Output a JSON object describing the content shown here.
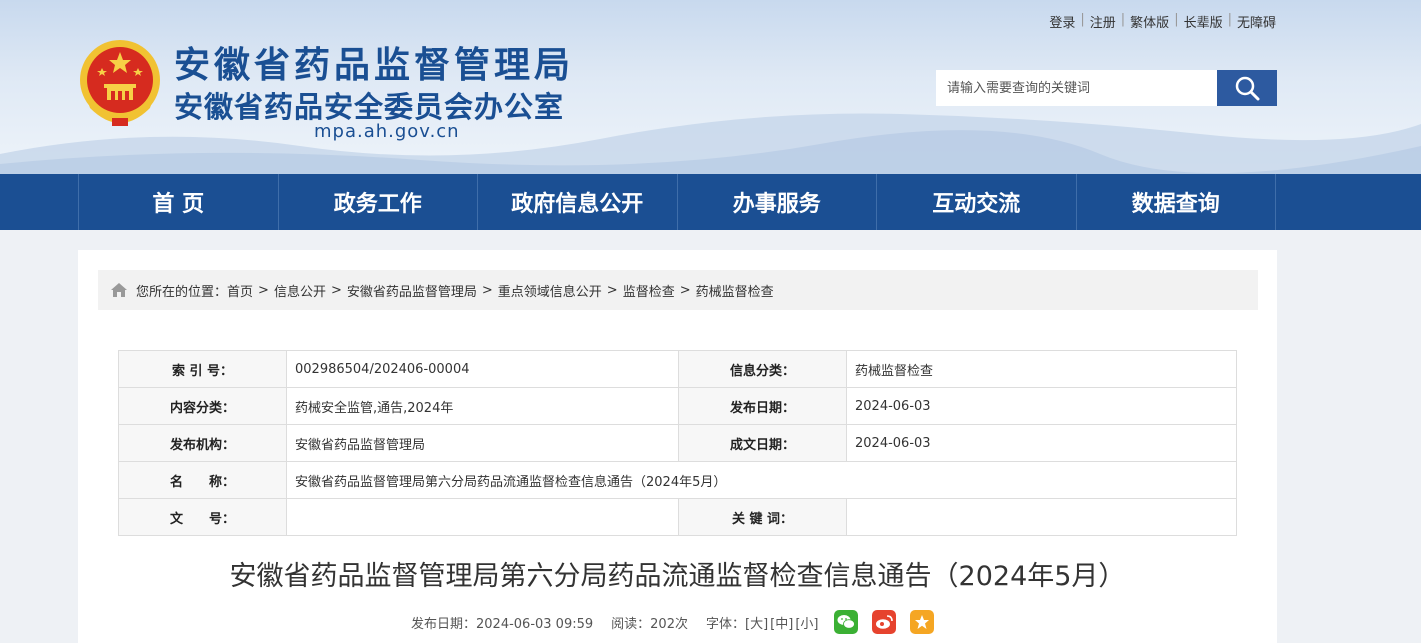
{
  "header": {
    "title_main": "安徽省药品监督管理局",
    "title_sub": "安徽省药品安全委员会办公室",
    "domain": "mpa.ah.gov.cn",
    "top_links": [
      "登录",
      "注册",
      "繁体版",
      "长辈版",
      "无障碍"
    ],
    "search": {
      "placeholder": "请输入需要查询的关键词"
    }
  },
  "nav": {
    "items": [
      "首 页",
      "政务工作",
      "政府信息公开",
      "办事服务",
      "互动交流",
      "数据查询"
    ]
  },
  "breadcrumb": {
    "prefix": "您所在的位置：",
    "items": [
      "首页",
      "信息公开",
      "安徽省药品监督管理局",
      "重点领域信息公开",
      "监督检查",
      "药械监督检查"
    ],
    "separator": ">"
  },
  "meta": {
    "index_label": "索 引 号：",
    "index_value": "002986504/202406-00004",
    "category_label": "信息分类：",
    "category_value": "药械监督检查",
    "content_type_label": "内容分类：",
    "content_type_value": "药械安全监管,通告,2024年",
    "publish_date_label": "发布日期：",
    "publish_date_value": "2024-06-03",
    "org_label": "发布机构：",
    "org_value": "安徽省药品监督管理局",
    "created_date_label": "成文日期：",
    "created_date_value": "2024-06-03",
    "name_label": "名　　称：",
    "name_value": "安徽省药品监督管理局第六分局药品流通监督检查信息通告（2024年5月）",
    "doc_no_label": "文　　号：",
    "doc_no_value": "",
    "keywords_label": "关 键 词：",
    "keywords_value": ""
  },
  "article": {
    "title": "安徽省药品监督管理局第六分局药品流通监督检查信息通告（2024年5月）",
    "publish_info": "发布日期：2024-06-03 09:59",
    "views": "阅读：202次",
    "font_label": "字体：",
    "font_large": "[大]",
    "font_medium": "[中]",
    "font_small": "[小]"
  },
  "colors": {
    "brand_blue": "#1b4f93",
    "wechat": "#3bb034",
    "weibo": "#e6432e",
    "favorite": "#f5a623"
  },
  "icons": [
    "national-emblem-icon",
    "search-icon",
    "home-icon",
    "wechat-icon",
    "weibo-icon",
    "star-icon"
  ]
}
